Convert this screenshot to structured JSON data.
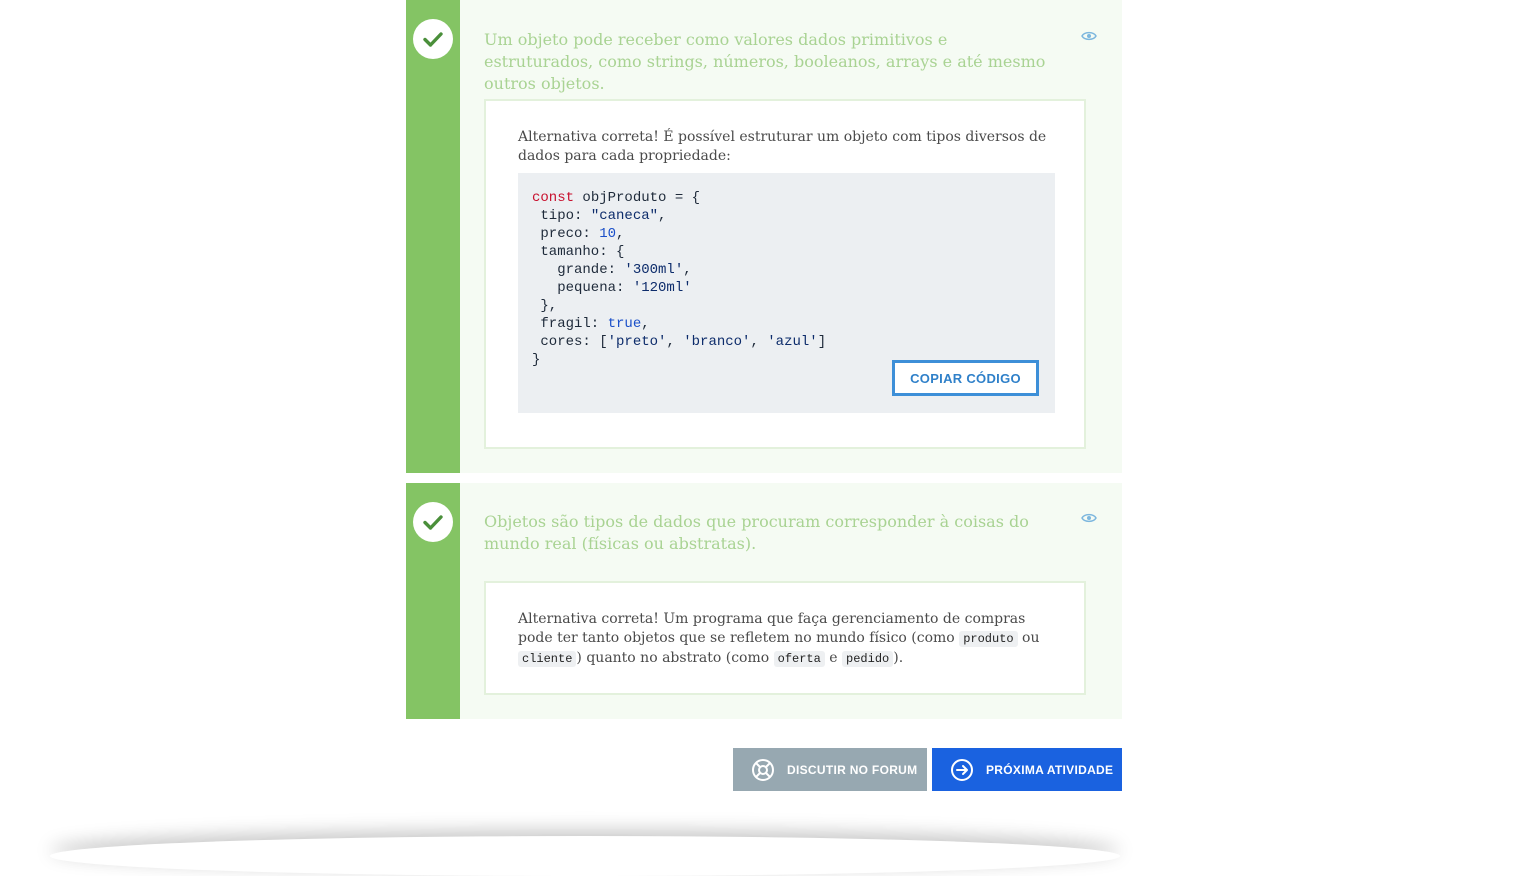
{
  "alternatives": [
    {
      "text": "Um objeto pode receber como valores dados primitivos e estruturados, como strings, números, booleanos, arrays e até mesmo outros objetos.",
      "feedback": "Alternativa correta! É possível estruturar um objeto com tipos diversos de dados para cada propriedade:",
      "copy_label": "COPIAR CÓDIGO"
    },
    {
      "text": "Objetos são tipos de dados que procuram corresponder à coisas do mundo real (físicas ou abstratas).",
      "feedback": {
        "p1": "Alternativa correta! Um programa que faça gerenciamento de compras pode ter tanto objetos que se refletem no mundo físico (como ",
        "code1": "produto",
        "p2": " ou ",
        "code2": "cliente",
        "p3": ") quanto no abstrato (como ",
        "code3": "oferta",
        "p4": " e ",
        "code4": "pedido",
        "p5": ")."
      }
    }
  ],
  "code": {
    "l1_kw": "const",
    "l1_rest": " objProduto = {",
    "l2_key": " tipo: ",
    "l2_val": "\"caneca\"",
    "l3_key": " preco: ",
    "l3_val": "10",
    "l4": " tamanho: {",
    "l5_key": "   grande: ",
    "l5_val": "'300ml'",
    "l6_key": "   pequena: ",
    "l6_val": "'120ml'",
    "l7": " },",
    "l8_key": " fragil: ",
    "l8_val": "true",
    "l9_key": " cores: [",
    "l9_v1": "'preto'",
    "l9_v2": "'branco'",
    "l9_v3": "'azul'",
    "l9_end": "]",
    "l10": "}"
  },
  "actions": {
    "forum_label": "DISCUTIR NO FORUM",
    "next_label": "PRÓXIMA ATIVIDADE"
  },
  "icons": {
    "check": "check-icon",
    "eye": "eye-icon",
    "forum": "lifebuoy-icon",
    "next": "arrow-right-circle-icon"
  },
  "colors": {
    "correct_green": "#84c464",
    "primary_blue": "#1a62e0",
    "secondary_gray": "#97a8b1"
  }
}
